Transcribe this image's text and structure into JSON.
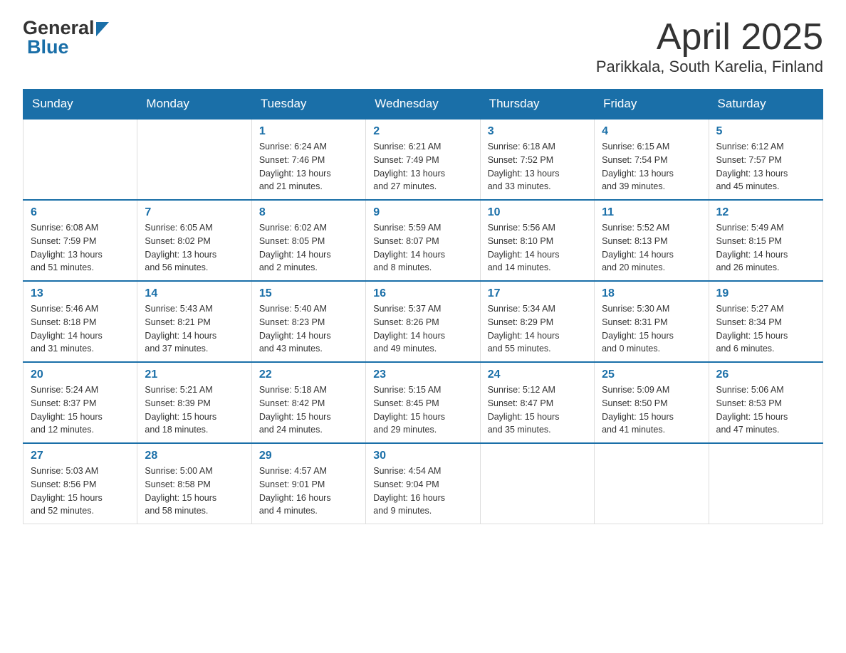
{
  "header": {
    "month_title": "April 2025",
    "location": "Parikkala, South Karelia, Finland",
    "logo_general": "General",
    "logo_blue": "Blue"
  },
  "weekdays": [
    "Sunday",
    "Monday",
    "Tuesday",
    "Wednesday",
    "Thursday",
    "Friday",
    "Saturday"
  ],
  "weeks": [
    [
      {
        "day": "",
        "info": ""
      },
      {
        "day": "",
        "info": ""
      },
      {
        "day": "1",
        "info": "Sunrise: 6:24 AM\nSunset: 7:46 PM\nDaylight: 13 hours\nand 21 minutes."
      },
      {
        "day": "2",
        "info": "Sunrise: 6:21 AM\nSunset: 7:49 PM\nDaylight: 13 hours\nand 27 minutes."
      },
      {
        "day": "3",
        "info": "Sunrise: 6:18 AM\nSunset: 7:52 PM\nDaylight: 13 hours\nand 33 minutes."
      },
      {
        "day": "4",
        "info": "Sunrise: 6:15 AM\nSunset: 7:54 PM\nDaylight: 13 hours\nand 39 minutes."
      },
      {
        "day": "5",
        "info": "Sunrise: 6:12 AM\nSunset: 7:57 PM\nDaylight: 13 hours\nand 45 minutes."
      }
    ],
    [
      {
        "day": "6",
        "info": "Sunrise: 6:08 AM\nSunset: 7:59 PM\nDaylight: 13 hours\nand 51 minutes."
      },
      {
        "day": "7",
        "info": "Sunrise: 6:05 AM\nSunset: 8:02 PM\nDaylight: 13 hours\nand 56 minutes."
      },
      {
        "day": "8",
        "info": "Sunrise: 6:02 AM\nSunset: 8:05 PM\nDaylight: 14 hours\nand 2 minutes."
      },
      {
        "day": "9",
        "info": "Sunrise: 5:59 AM\nSunset: 8:07 PM\nDaylight: 14 hours\nand 8 minutes."
      },
      {
        "day": "10",
        "info": "Sunrise: 5:56 AM\nSunset: 8:10 PM\nDaylight: 14 hours\nand 14 minutes."
      },
      {
        "day": "11",
        "info": "Sunrise: 5:52 AM\nSunset: 8:13 PM\nDaylight: 14 hours\nand 20 minutes."
      },
      {
        "day": "12",
        "info": "Sunrise: 5:49 AM\nSunset: 8:15 PM\nDaylight: 14 hours\nand 26 minutes."
      }
    ],
    [
      {
        "day": "13",
        "info": "Sunrise: 5:46 AM\nSunset: 8:18 PM\nDaylight: 14 hours\nand 31 minutes."
      },
      {
        "day": "14",
        "info": "Sunrise: 5:43 AM\nSunset: 8:21 PM\nDaylight: 14 hours\nand 37 minutes."
      },
      {
        "day": "15",
        "info": "Sunrise: 5:40 AM\nSunset: 8:23 PM\nDaylight: 14 hours\nand 43 minutes."
      },
      {
        "day": "16",
        "info": "Sunrise: 5:37 AM\nSunset: 8:26 PM\nDaylight: 14 hours\nand 49 minutes."
      },
      {
        "day": "17",
        "info": "Sunrise: 5:34 AM\nSunset: 8:29 PM\nDaylight: 14 hours\nand 55 minutes."
      },
      {
        "day": "18",
        "info": "Sunrise: 5:30 AM\nSunset: 8:31 PM\nDaylight: 15 hours\nand 0 minutes."
      },
      {
        "day": "19",
        "info": "Sunrise: 5:27 AM\nSunset: 8:34 PM\nDaylight: 15 hours\nand 6 minutes."
      }
    ],
    [
      {
        "day": "20",
        "info": "Sunrise: 5:24 AM\nSunset: 8:37 PM\nDaylight: 15 hours\nand 12 minutes."
      },
      {
        "day": "21",
        "info": "Sunrise: 5:21 AM\nSunset: 8:39 PM\nDaylight: 15 hours\nand 18 minutes."
      },
      {
        "day": "22",
        "info": "Sunrise: 5:18 AM\nSunset: 8:42 PM\nDaylight: 15 hours\nand 24 minutes."
      },
      {
        "day": "23",
        "info": "Sunrise: 5:15 AM\nSunset: 8:45 PM\nDaylight: 15 hours\nand 29 minutes."
      },
      {
        "day": "24",
        "info": "Sunrise: 5:12 AM\nSunset: 8:47 PM\nDaylight: 15 hours\nand 35 minutes."
      },
      {
        "day": "25",
        "info": "Sunrise: 5:09 AM\nSunset: 8:50 PM\nDaylight: 15 hours\nand 41 minutes."
      },
      {
        "day": "26",
        "info": "Sunrise: 5:06 AM\nSunset: 8:53 PM\nDaylight: 15 hours\nand 47 minutes."
      }
    ],
    [
      {
        "day": "27",
        "info": "Sunrise: 5:03 AM\nSunset: 8:56 PM\nDaylight: 15 hours\nand 52 minutes."
      },
      {
        "day": "28",
        "info": "Sunrise: 5:00 AM\nSunset: 8:58 PM\nDaylight: 15 hours\nand 58 minutes."
      },
      {
        "day": "29",
        "info": "Sunrise: 4:57 AM\nSunset: 9:01 PM\nDaylight: 16 hours\nand 4 minutes."
      },
      {
        "day": "30",
        "info": "Sunrise: 4:54 AM\nSunset: 9:04 PM\nDaylight: 16 hours\nand 9 minutes."
      },
      {
        "day": "",
        "info": ""
      },
      {
        "day": "",
        "info": ""
      },
      {
        "day": "",
        "info": ""
      }
    ]
  ]
}
